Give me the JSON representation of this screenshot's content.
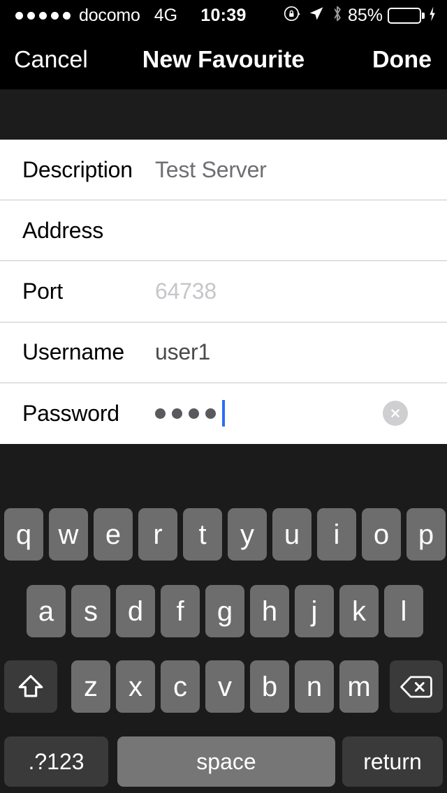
{
  "statusbar": {
    "carrier": "docomo",
    "network": "4G",
    "time": "10:39",
    "battery_percent": "85%",
    "icons": [
      "rotation-lock-icon",
      "location-arrow-icon",
      "bluetooth-icon",
      "battery-icon",
      "charging-bolt-icon"
    ],
    "battery_fill_color": "#4cd964",
    "battery_level": 85
  },
  "navbar": {
    "cancel_label": "Cancel",
    "title": "New Favourite",
    "done_label": "Done"
  },
  "form": {
    "rows": [
      {
        "label": "Description",
        "value": "Test Server",
        "value_kind": "placeholder-dark"
      },
      {
        "label": "Address",
        "value": "",
        "value_kind": "empty"
      },
      {
        "label": "Port",
        "value": "64738",
        "value_kind": "placeholder-light"
      },
      {
        "label": "Username",
        "value": "user1",
        "value_kind": "text"
      },
      {
        "label": "Password",
        "value": "••••",
        "value_kind": "secure"
      }
    ],
    "password_dot_count": 4,
    "caret_color": "#2b6ef6",
    "clear_button_label": "Clear text"
  },
  "keyboard": {
    "row1": [
      "q",
      "w",
      "e",
      "r",
      "t",
      "y",
      "u",
      "i",
      "o",
      "p"
    ],
    "row2": [
      "a",
      "s",
      "d",
      "f",
      "g",
      "h",
      "j",
      "k",
      "l"
    ],
    "row3": [
      "z",
      "x",
      "c",
      "v",
      "b",
      "n",
      "m"
    ],
    "shift_label": "shift",
    "backspace_label": "backspace",
    "numbers_label": ".?123",
    "space_label": "space",
    "return_label": "return",
    "key_color": "#6d6d6d",
    "function_key_color": "#3a3a3a",
    "space_key_color": "#767676",
    "background_color": "#1b1b1b"
  }
}
